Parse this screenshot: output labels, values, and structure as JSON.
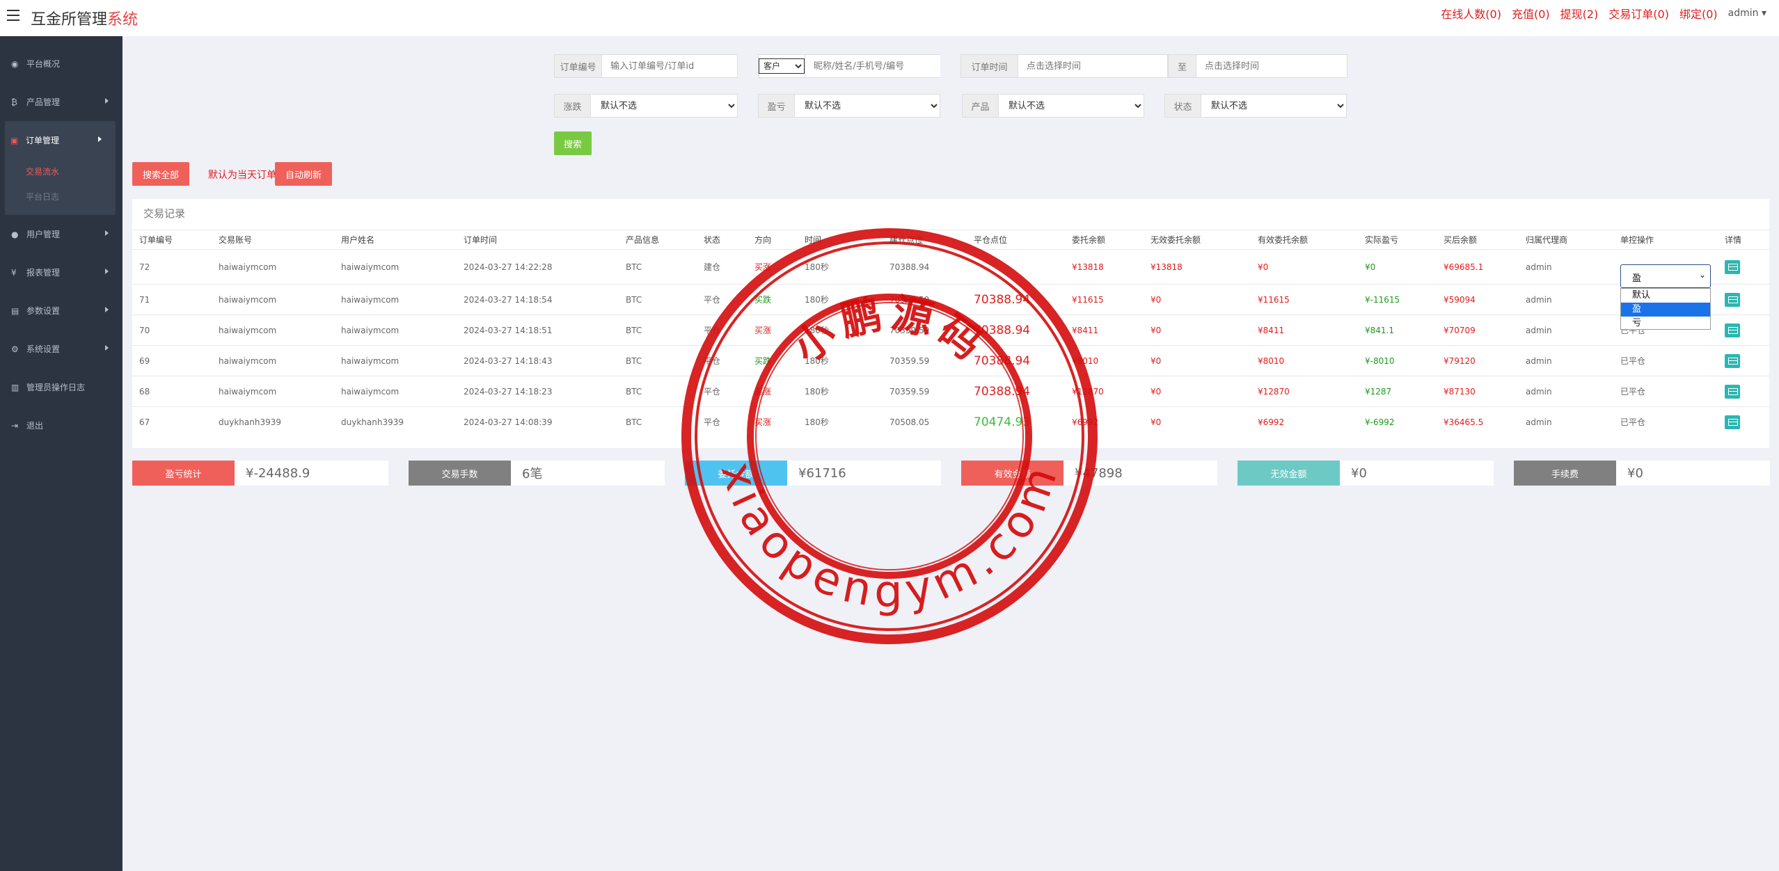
{
  "header": {
    "title_main": "互金所管理",
    "title_accent": "系统",
    "links": [
      "在线人数(0)",
      "充值(0)",
      "提现(2)",
      "交易订单(0)",
      "绑定(0)"
    ],
    "user": "admin"
  },
  "sidebar": {
    "items": [
      {
        "label": "平台概况",
        "icon": "dashboard-icon"
      },
      {
        "label": "产品管理",
        "icon": "bitcoin-icon"
      },
      {
        "label": "订单管理",
        "icon": "order-icon"
      },
      {
        "label": "用户管理",
        "icon": "user-icon"
      },
      {
        "label": "报表管理",
        "icon": "yen-icon"
      },
      {
        "label": "参数设置",
        "icon": "settings-icon"
      },
      {
        "label": "系统设置",
        "icon": "gears-icon"
      },
      {
        "label": "管理员操作日志",
        "icon": "log-icon"
      },
      {
        "label": "退出",
        "icon": "exit-icon"
      }
    ],
    "sub_items": [
      "交易流水",
      "平台日志"
    ]
  },
  "filters": {
    "order_no_label": "订单编号",
    "order_no_placeholder": "输入订单编号/订单id",
    "customer_select": "客户",
    "customer_placeholder": "昵称/姓名/手机号/编号",
    "time_label": "订单时间",
    "time_start_placeholder": "点击选择时间",
    "to_label": "至",
    "time_end_placeholder": "点击选择时间",
    "rise_label": "涨跌",
    "pl_label": "盈亏",
    "product_label": "产品",
    "status_label": "状态",
    "default_option": "默认不选",
    "search_button": "搜索"
  },
  "actions": {
    "search_all": "搜索全部",
    "note": "默认为当天订单",
    "auto_refresh": "自动刷新"
  },
  "table": {
    "title": "交易记录",
    "columns": [
      "订单编号",
      "交易账号",
      "用户姓名",
      "订单时间",
      "产品信息",
      "状态",
      "方向",
      "时间",
      "建仓点位",
      "平仓点位",
      "委托余额",
      "无效委托余额",
      "有效委托余额",
      "实际盈亏",
      "买后余额",
      "归属代理商",
      "单控操作",
      "详情"
    ],
    "rows": [
      {
        "id": "72",
        "account": "haiwaiymcom",
        "name": "haiwaiymcom",
        "time": "2024-03-27 14:22:28",
        "product": "BTC",
        "status": "建仓",
        "direction": "买涨",
        "duration": "180秒",
        "open": "70388.94",
        "close": "",
        "amount": "¥13818",
        "invalid": "¥13818",
        "valid": "¥0",
        "pl": "¥0",
        "balance": "¥69685.1",
        "agent": "admin",
        "control": "盈"
      },
      {
        "id": "71",
        "account": "haiwaiymcom",
        "name": "haiwaiymcom",
        "time": "2024-03-27 14:18:54",
        "product": "BTC",
        "status": "平仓",
        "direction": "买跌",
        "duration": "180秒",
        "open": "70359.59",
        "close": "70388.94",
        "amount": "¥11615",
        "invalid": "¥0",
        "valid": "¥11615",
        "pl": "¥-11615",
        "balance": "¥59094",
        "agent": "admin",
        "control": ""
      },
      {
        "id": "70",
        "account": "haiwaiymcom",
        "name": "haiwaiymcom",
        "time": "2024-03-27 14:18:51",
        "product": "BTC",
        "status": "平仓",
        "direction": "买涨",
        "duration": "180秒",
        "open": "70359.59",
        "close": "70388.94",
        "amount": "¥8411",
        "invalid": "¥0",
        "valid": "¥8411",
        "pl": "¥841.1",
        "balance": "¥70709",
        "agent": "admin",
        "control": "已平仓"
      },
      {
        "id": "69",
        "account": "haiwaiymcom",
        "name": "haiwaiymcom",
        "time": "2024-03-27 14:18:43",
        "product": "BTC",
        "status": "平仓",
        "direction": "买跌",
        "duration": "180秒",
        "open": "70359.59",
        "close": "70388.94",
        "amount": "¥8010",
        "invalid": "¥0",
        "valid": "¥8010",
        "pl": "¥-8010",
        "balance": "¥79120",
        "agent": "admin",
        "control": "已平仓"
      },
      {
        "id": "68",
        "account": "haiwaiymcom",
        "name": "haiwaiymcom",
        "time": "2024-03-27 14:18:23",
        "product": "BTC",
        "status": "平仓",
        "direction": "买涨",
        "duration": "180秒",
        "open": "70359.59",
        "close": "70388.94",
        "amount": "¥12870",
        "invalid": "¥0",
        "valid": "¥12870",
        "pl": "¥1287",
        "balance": "¥87130",
        "agent": "admin",
        "control": "已平仓"
      },
      {
        "id": "67",
        "account": "duykhanh3939",
        "name": "duykhanh3939",
        "time": "2024-03-27 14:08:39",
        "product": "BTC",
        "status": "平仓",
        "direction": "买涨",
        "duration": "180秒",
        "open": "70508.05",
        "close": "70474.93",
        "amount": "¥6992",
        "invalid": "¥0",
        "valid": "¥6992",
        "pl": "¥-6992",
        "balance": "¥36465.5",
        "agent": "admin",
        "control": "已平仓"
      }
    ]
  },
  "dropdown": {
    "options": [
      "默认",
      "盈",
      "亏"
    ],
    "selected": "盈"
  },
  "stats": [
    {
      "label": "盈亏统计",
      "value": "¥-24488.9",
      "color": "#f0605a"
    },
    {
      "label": "交易手数",
      "value": "6笔",
      "color": "#808080"
    },
    {
      "label": "委托金额",
      "value": "¥61716",
      "color": "#4fc3f0"
    },
    {
      "label": "有效金额",
      "value": "¥47898",
      "color": "#f0605a"
    },
    {
      "label": "无效金额",
      "value": "¥0",
      "color": "#6cc9c4"
    },
    {
      "label": "手续费",
      "value": "¥0",
      "color": "#808080"
    }
  ],
  "watermark": {
    "cn": "小鹏源码",
    "url": "xiaopengym.com"
  },
  "colors": {
    "sidebar": "#2c3441",
    "accent_red": "#e21d1d",
    "search_green": "#7ac943",
    "button_red": "#f0605a"
  }
}
